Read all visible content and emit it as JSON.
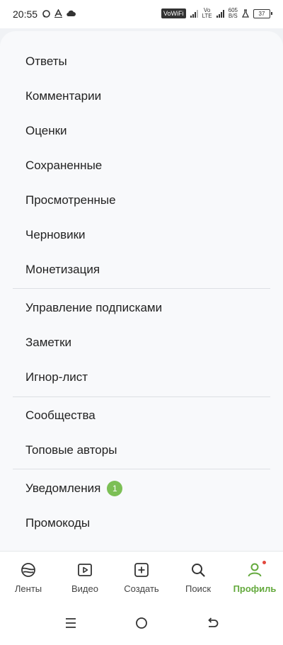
{
  "status": {
    "time": "20:55",
    "vowifi": "VoWiFi",
    "volte_top": "Vo",
    "volte_bottom": "LTE",
    "speed_top": "605",
    "speed_bottom": "B/S",
    "battery": "37"
  },
  "menu": {
    "answers": "Ответы",
    "comments": "Комментарии",
    "ratings": "Оценки",
    "saved": "Сохраненные",
    "viewed": "Просмотренные",
    "drafts": "Черновики",
    "monetization": "Монетизация",
    "subscriptions": "Управление подписками",
    "notes": "Заметки",
    "ignore_list": "Игнор-лист",
    "communities": "Сообщества",
    "top_authors": "Топовые авторы",
    "notifications": "Уведомления",
    "notifications_count": "1",
    "promocodes": "Промокоды"
  },
  "bottom_nav": {
    "feeds": "Ленты",
    "video": "Видео",
    "create": "Создать",
    "search": "Поиск",
    "profile": "Профиль"
  },
  "colors": {
    "accent": "#63a93c",
    "badge": "#7cbf55",
    "dot": "#e2483d"
  },
  "icons": [
    "feeds-icon",
    "video-icon",
    "create-icon",
    "search-icon",
    "profile-icon",
    "menu-icon",
    "home-icon",
    "back-icon"
  ]
}
